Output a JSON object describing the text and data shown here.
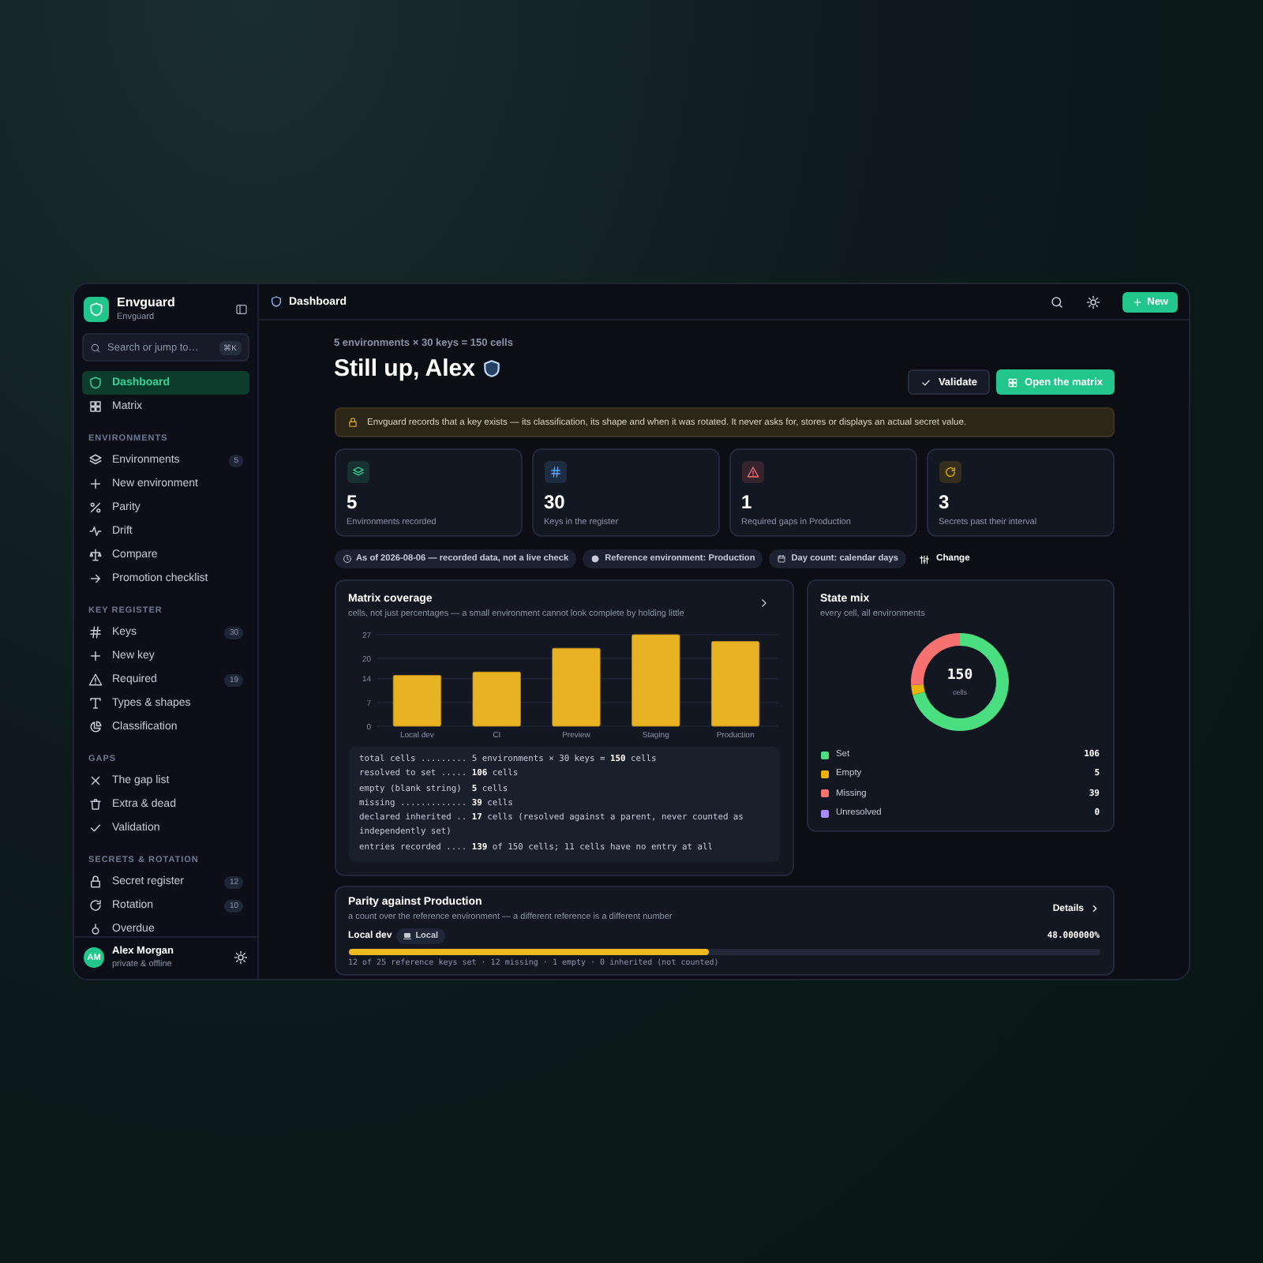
{
  "app": {
    "name": "Envguard",
    "subtitle": "Envguard"
  },
  "search": {
    "placeholder": "Search or jump to…",
    "shortcut": "⌘K"
  },
  "nav": [
    {
      "items": [
        {
          "label": "Dashboard",
          "selected": true
        },
        {
          "label": "Matrix",
          "selected": false
        }
      ]
    },
    {
      "title": "ENVIRONMENTS",
      "items": [
        {
          "label": "Environments",
          "selected": false,
          "badge": "5"
        },
        {
          "label": "New environment",
          "selected": false
        },
        {
          "label": "Parity",
          "selected": false
        },
        {
          "label": "Drift",
          "selected": false
        },
        {
          "label": "Compare",
          "selected": false
        },
        {
          "label": "Promotion checklist",
          "selected": false
        }
      ]
    },
    {
      "title": "KEY REGISTER",
      "items": [
        {
          "label": "Keys",
          "selected": false,
          "badge": "30"
        },
        {
          "label": "New key",
          "selected": false
        },
        {
          "label": "Required",
          "selected": false,
          "badge": "19"
        },
        {
          "label": "Types & shapes",
          "selected": false
        },
        {
          "label": "Classification",
          "selected": false
        }
      ]
    },
    {
      "title": "GAPS",
      "items": [
        {
          "label": "The gap list",
          "selected": false
        },
        {
          "label": "Extra & dead",
          "selected": false
        },
        {
          "label": "Validation",
          "selected": false
        }
      ]
    },
    {
      "title": "SECRETS & ROTATION",
      "items": [
        {
          "label": "Secret register",
          "selected": false,
          "badge": "12"
        },
        {
          "label": "Rotation",
          "selected": false,
          "badge": "10"
        },
        {
          "label": "Overdue",
          "selected": false
        }
      ]
    }
  ],
  "user": {
    "initials": "AM",
    "name": "Alex Morgan",
    "status": "private & offline"
  },
  "topbar": {
    "title": "Dashboard",
    "new_button": "New"
  },
  "summary": "5 environments × 30 keys = 150 cells",
  "greeting": "Still up, Alex",
  "actions": [
    {
      "label": "Validate",
      "kind": "secondary"
    },
    {
      "label": "Open the matrix",
      "kind": "primary"
    }
  ],
  "notice": "Envguard records that a key exists — its classification, its shape and when it was rotated. It never asks for, stores or displays an actual secret value.",
  "stats": [
    {
      "value": "5",
      "label": "Environments recorded",
      "color": "#34d399"
    },
    {
      "value": "30",
      "label": "Keys in the register",
      "color": "#60a5fa"
    },
    {
      "value": "1",
      "label": "Required gaps in Production",
      "color": "#f87171"
    },
    {
      "value": "3",
      "label": "Secrets past their interval",
      "color": "#eab308"
    }
  ],
  "chips": [
    "As of 2026-08-06 — recorded data, not a live check",
    "Reference environment: Production",
    "Day count: calendar days"
  ],
  "change_button": "Change",
  "coverage": {
    "title": "Matrix coverage",
    "subtitle": "cells, not just percentages — a small environment cannot look complete by holding little",
    "chart_data": {
      "type": "bar",
      "categories": [
        "Local dev",
        "CI",
        "Preview",
        "Staging",
        "Production"
      ],
      "values": [
        15,
        16,
        23,
        27,
        25
      ],
      "ylim": [
        0,
        27
      ],
      "grid": true,
      "yticks": [
        0,
        7,
        14,
        20,
        27
      ]
    },
    "breakdown": [
      "total cells ......... 5 environments × 30 keys = **150** cells",
      "resolved to set ..... **106** cells",
      "empty (blank string)  **5** cells",
      "missing ............. **39** cells",
      "declared inherited .. **17** cells (resolved against a parent, never counted as independently set)",
      "entries recorded .... **139** of 150 cells; 11 cells have no entry at all"
    ]
  },
  "state_mix": {
    "title": "State mix",
    "subtitle": "every cell, all environments",
    "total": "150",
    "total_label": "cells",
    "chart_data": {
      "type": "donut",
      "categories": [
        "Set",
        "Empty",
        "Missing",
        "Unresolved"
      ],
      "values": [
        70.67,
        3.33,
        26,
        0
      ]
    },
    "legend": [
      {
        "value": "106",
        "color": "#4ade80"
      },
      {
        "value": "5",
        "color": "#eab308"
      },
      {
        "value": "39",
        "color": "#f87171"
      },
      {
        "value": "0",
        "color": "#a78bfa"
      }
    ]
  },
  "parity": {
    "title": "Parity against Production",
    "subtitle": "a count over the reference environment — a different reference is a different number",
    "details": "Details",
    "rows": [
      {
        "name": "Local dev",
        "tag": "Local",
        "percent": "48.000000%",
        "level": 0.48,
        "detail": "12 of 25 reference keys set · 12 missing · 1 empty · 0 inherited (not counted)"
      }
    ]
  }
}
